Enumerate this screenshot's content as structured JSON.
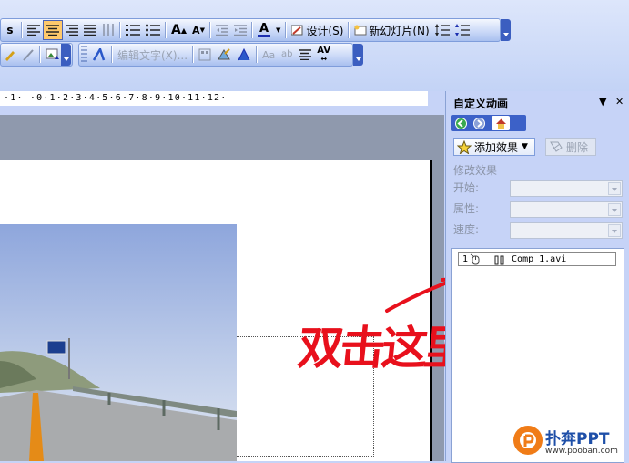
{
  "toolbar1": {
    "bold_partial": "s",
    "font_grow": "A",
    "font_color": "A",
    "design_label": "设计(S)",
    "new_slide_label": "新幻灯片(N)"
  },
  "toolbar2": {
    "edit_text_label": "编辑文字(X)...",
    "char_spacing": "AV"
  },
  "ruler": {
    "text": "·1·  ·0·1·2·3·4·5·6·7·8·9·10·11·12·"
  },
  "task_pane": {
    "title": "自定义动画",
    "dropdown_glyph": "▼",
    "close_glyph": "✕",
    "add_effect_label": "添加效果",
    "remove_label": "删除",
    "modify_section": "修改效果",
    "start_label": "开始:",
    "property_label": "属性:",
    "speed_label": "速度:",
    "effects": [
      {
        "index": "1",
        "name": "Comp 1.avi"
      }
    ]
  },
  "annotation": {
    "text": "双击这里",
    "color": "#e8101c"
  },
  "watermark": {
    "brand": "PPT",
    "brand_cn": "扑奔",
    "url": "www.pooban.com"
  },
  "colors": {
    "toolbar_bg": "#c8d7f7",
    "active_button": "#ffc96b",
    "pane_nav": "#3c61c8"
  }
}
